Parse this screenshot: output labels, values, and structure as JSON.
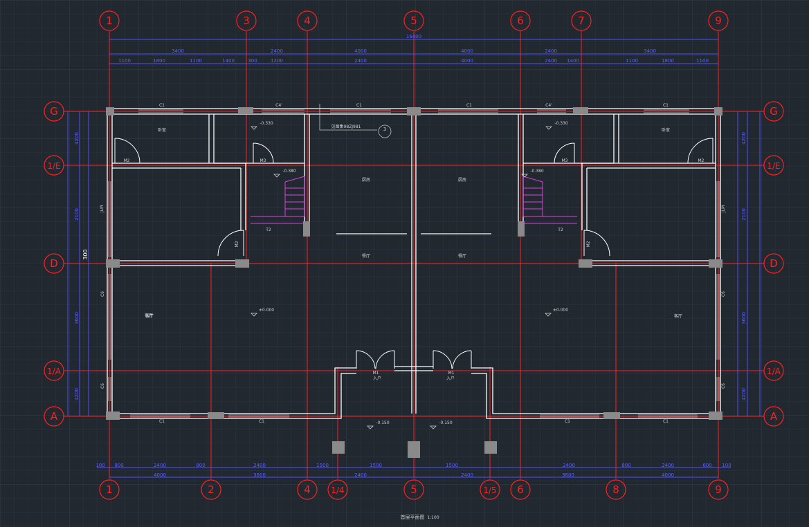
{
  "cad": {
    "grid_top": [
      "1",
      "3",
      "4",
      "5",
      "6",
      "7",
      "9"
    ],
    "grid_bottom": [
      "1",
      "2",
      "4",
      "1/4",
      "5",
      "1/5",
      "6",
      "8",
      "9"
    ],
    "grid_left": [
      "G",
      "1/E",
      "D",
      "1/A",
      "A"
    ],
    "grid_right": [
      "G",
      "1/E",
      "D",
      "1/A",
      "A"
    ],
    "dims_top_total": "16400",
    "dims_top_row1": [
      "3400",
      "2400",
      "4000",
      "4000",
      "2400",
      "3400"
    ],
    "dims_top_row2": [
      "1100",
      "1800",
      "1100",
      "1400",
      "300",
      "1200",
      "2400",
      "4000",
      "2400",
      "1400",
      "1100",
      "1800",
      "1100"
    ],
    "dims_bottom_row1": [
      "100",
      "800",
      "2400",
      "800",
      "2400",
      "1500",
      "1500",
      "1500",
      "2400",
      "800",
      "2400",
      "800",
      "100"
    ],
    "dims_bottom_row2": [
      "4000",
      "3600",
      "2400",
      "2400",
      "3600",
      "4000"
    ],
    "dims_left": [
      "4200",
      "2100",
      "3600",
      "4200"
    ],
    "dims_right": [
      "4200",
      "2100",
      "3600",
      "4200"
    ],
    "window_labels": [
      "C1",
      "C4'",
      "C1",
      "C1",
      "C4'",
      "C1",
      "C1",
      "C1",
      "C1",
      "C1",
      "C6",
      "C6",
      "C6",
      "C6",
      "JLM",
      "JLM"
    ],
    "door_labels": [
      "M2",
      "M3",
      "M2",
      "M3",
      "M2",
      "M2",
      "M1",
      "M1"
    ],
    "room_labels": [
      "卧室",
      "厨房",
      "客厅",
      "厨房",
      "卧室",
      "餐厅",
      "餐厅",
      "客厅",
      "客厅"
    ],
    "levels": [
      "-0.330",
      "-0.380",
      "±0.000",
      "-0.150",
      "-0.330",
      "-0.380",
      "±0.000",
      "-0.150"
    ],
    "entries": [
      "入户",
      "入户"
    ],
    "stair_labels": [
      "T2",
      "T2"
    ],
    "detail_ref": "见图集98ZJ981",
    "detail_num": "3",
    "drawing_title": "首层平面图",
    "drawing_scale": "1:100",
    "misc_label": "300"
  }
}
